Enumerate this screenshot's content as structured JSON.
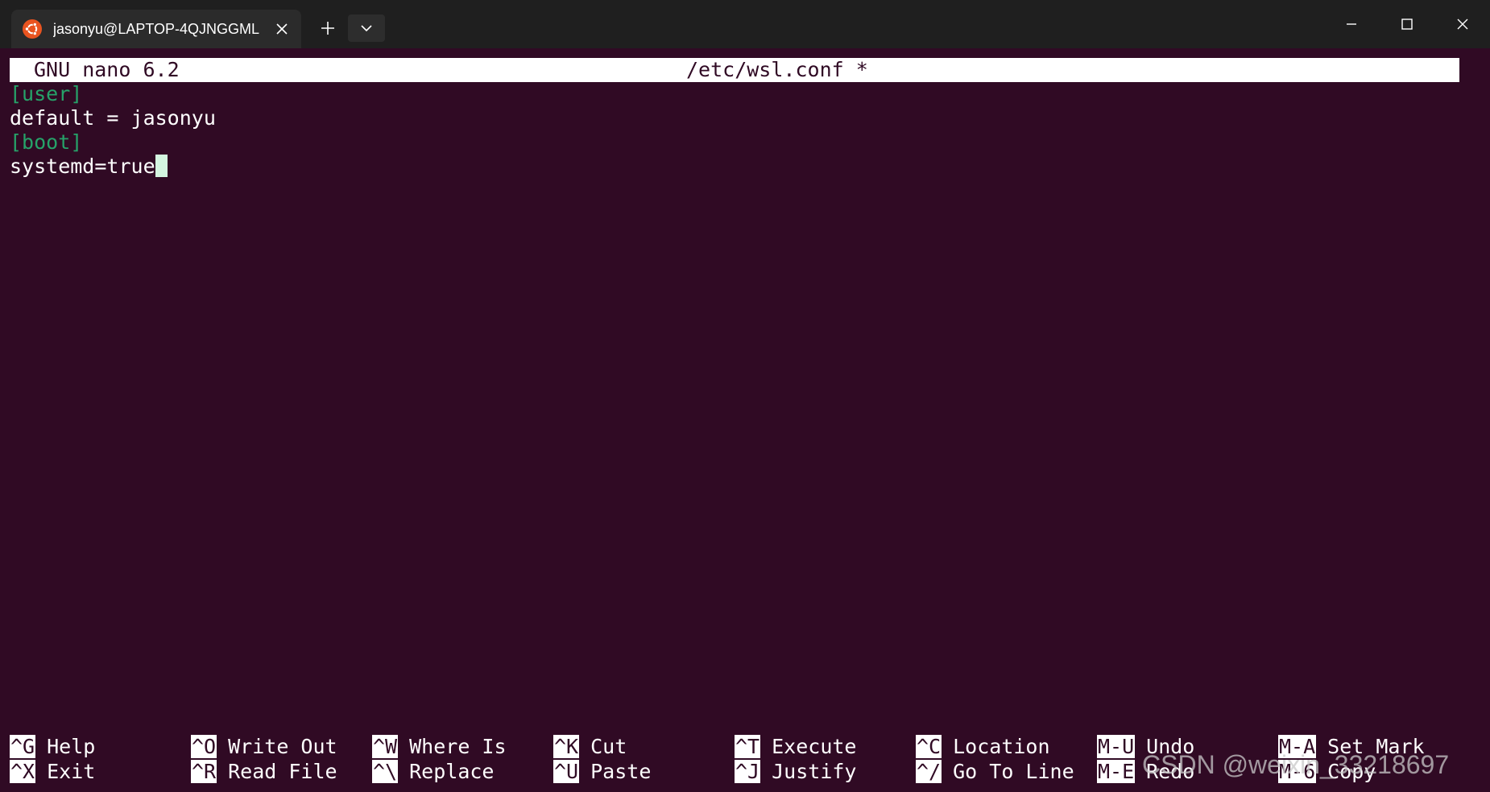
{
  "window": {
    "tab_title": "jasonyu@LAPTOP-4QJNGGML",
    "tab_icon": "ubuntu-icon",
    "new_tab_icon": "plus-icon",
    "dropdown_icon": "chevron-down-icon",
    "controls": [
      "minimize-icon",
      "maximize-icon",
      "close-icon"
    ]
  },
  "nano": {
    "version": "GNU nano 6.2",
    "filename": "/etc/wsl.conf *"
  },
  "editor": {
    "lines": [
      {
        "text": "[user]",
        "type": "section"
      },
      {
        "text": "default = jasonyu",
        "type": "plain"
      },
      {
        "text": "[boot]",
        "type": "section"
      },
      {
        "text": "systemd=true",
        "type": "plain",
        "cursor": true
      }
    ]
  },
  "shortcuts": {
    "row1": [
      {
        "key": "^G",
        "label": "Help"
      },
      {
        "key": "^O",
        "label": "Write Out"
      },
      {
        "key": "^W",
        "label": "Where Is"
      },
      {
        "key": "^K",
        "label": "Cut"
      },
      {
        "key": "^T",
        "label": "Execute"
      },
      {
        "key": "^C",
        "label": "Location"
      },
      {
        "key": "M-U",
        "label": "Undo"
      },
      {
        "key": "M-A",
        "label": "Set Mark"
      }
    ],
    "row2": [
      {
        "key": "^X",
        "label": "Exit"
      },
      {
        "key": "^R",
        "label": "Read File"
      },
      {
        "key": "^\\",
        "label": "Replace"
      },
      {
        "key": "^U",
        "label": "Paste"
      },
      {
        "key": "^J",
        "label": "Justify"
      },
      {
        "key": "^/",
        "label": "Go To Line"
      },
      {
        "key": "M-E",
        "label": "Redo"
      },
      {
        "key": "M-6",
        "label": "Copy"
      }
    ]
  },
  "watermark": "CSDN @weixin_33218697",
  "colors": {
    "background": "#300a24",
    "section": "#26a269",
    "cursor": "#d4f5e0",
    "titlebar": "#1f1f1f",
    "tab": "#2b2b2b",
    "ubuntu_orange": "#e95420"
  }
}
